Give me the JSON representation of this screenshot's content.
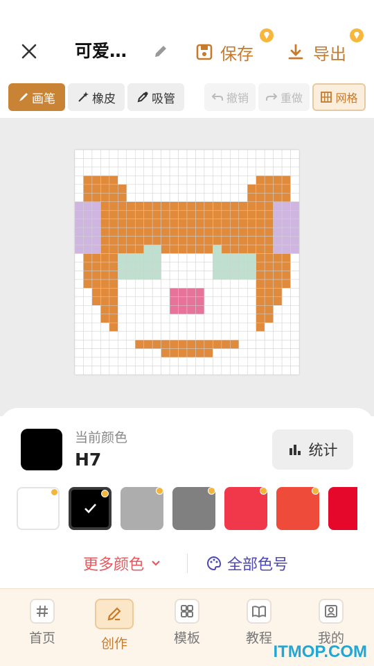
{
  "header": {
    "title": "可爱…",
    "save_label": "保存",
    "export_label": "导出"
  },
  "toolbar": {
    "brush_label": "画笔",
    "eraser_label": "橡皮",
    "eyedropper_label": "吸管",
    "undo_label": "撤销",
    "redo_label": "重做",
    "grid_label": "网格"
  },
  "colors": {
    "accent": "#c98335",
    "fox_orange": "#e08a3c",
    "fox_pink": "#e8739a",
    "fox_lilac": "#cfb6e0",
    "fox_mint": "#bfe0cf"
  },
  "current_color": {
    "label": "当前颜色",
    "code": "H7",
    "hex": "#000000"
  },
  "stats_label": "统计",
  "palette": [
    {
      "hex": "#ffffff",
      "selected": false
    },
    {
      "hex": "#000000",
      "selected": true
    },
    {
      "hex": "#adadad",
      "selected": false
    },
    {
      "hex": "#808080",
      "selected": false
    },
    {
      "hex": "#f0384a",
      "selected": false
    },
    {
      "hex": "#ef4b3a",
      "selected": false
    },
    {
      "hex": "#e5082a",
      "selected": false
    }
  ],
  "more_colors_label": "更多颜色",
  "all_colors_label": "全部色号",
  "nav": {
    "home": "首页",
    "create": "创作",
    "templates": "模板",
    "tutorials": "教程",
    "mine": "我的"
  },
  "watermark": "ITMOP.COM"
}
